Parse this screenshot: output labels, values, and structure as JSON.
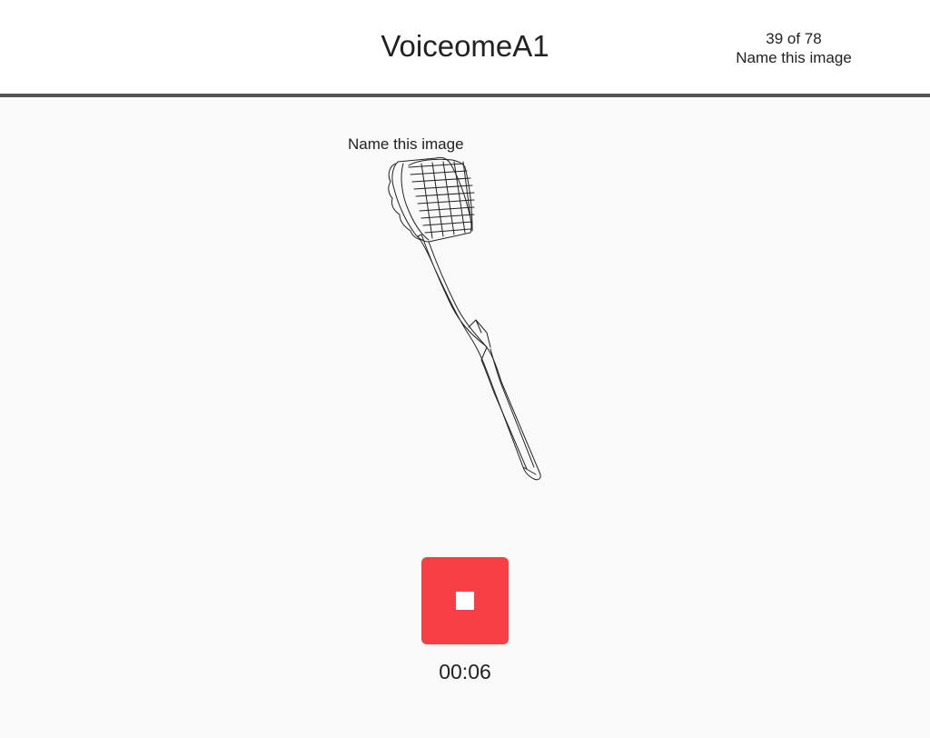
{
  "header": {
    "app_title": "VoiceomeA1",
    "progress": "39 of 78",
    "task_name": "Name this image"
  },
  "prompt": {
    "label": "Name this image",
    "image_icon": "toothbrush-line-drawing"
  },
  "recorder": {
    "button_icon": "stop-icon",
    "button_color": "#f73f45",
    "elapsed": "00:06"
  },
  "colors": {
    "header_bg": "#ffffff",
    "header_rule": "#555555",
    "page_bg": "#f9f9f9",
    "text": "#222222"
  }
}
